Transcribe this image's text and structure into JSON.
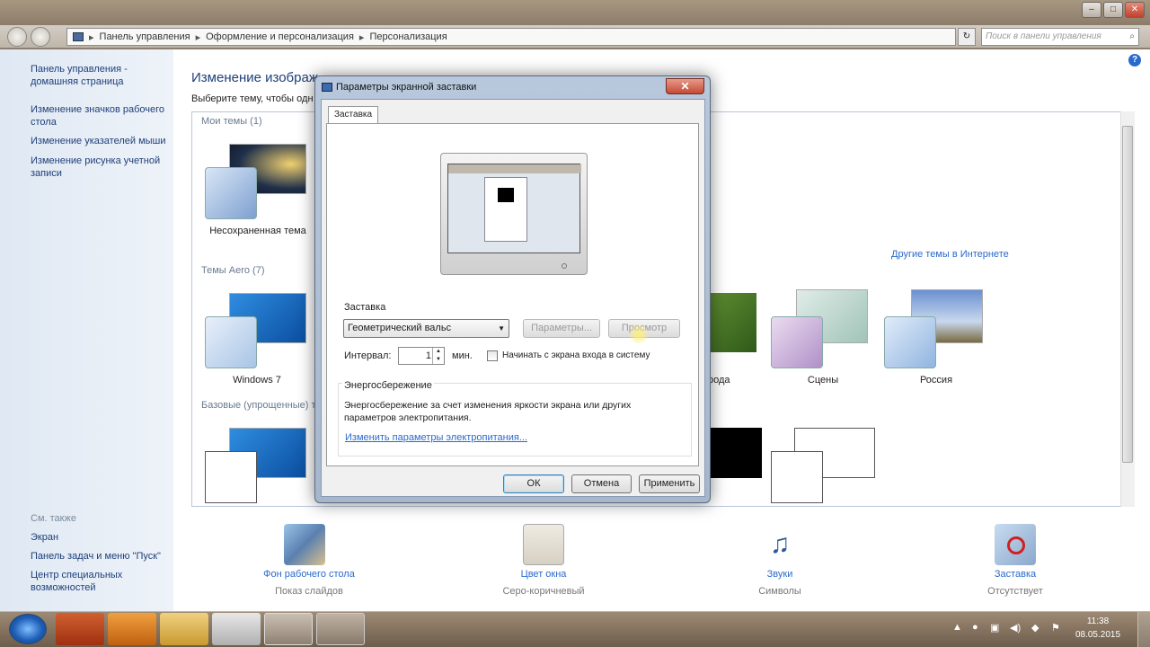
{
  "explorer": {
    "breadcrumb": [
      "Панель управления",
      "Оформление и персонализация",
      "Персонализация"
    ],
    "search_placeholder": "Поиск в панели управления"
  },
  "sidebar": {
    "links": [
      "Панель управления - домашняя страница",
      "Изменение значков рабочего стола",
      "Изменение указателей мыши",
      "Изменение рисунка учетной записи"
    ],
    "see_also_heading": "См. также",
    "see_also": [
      "Экран",
      "Панель задач и меню \"Пуск\"",
      "Центр специальных возможностей"
    ]
  },
  "main": {
    "title": "Изменение изображ",
    "subtitle": "Выберите тему, чтобы одн",
    "groups": {
      "my_themes": "Мои темы (1)",
      "aero": "Темы Aero (7)",
      "basic": "Базовые (упрощенные) т"
    },
    "themes": {
      "unsaved": "Несохраненная тема",
      "win7": "Windows 7",
      "nature": "рода",
      "scenes": "Сцены",
      "russia": "Россия"
    },
    "more_themes_link": "Другие темы в Интернете"
  },
  "bottom": [
    {
      "label": "Фон рабочего стола",
      "sub": "Показ слайдов"
    },
    {
      "label": "Цвет окна",
      "sub": "Серо-коричневый"
    },
    {
      "label": "Звуки",
      "sub": "Символы"
    },
    {
      "label": "Заставка",
      "sub": "Отсутствует"
    }
  ],
  "dialog": {
    "title": "Параметры экранной заставки",
    "tab": "Заставка",
    "screensaver_label": "Заставка",
    "screensaver_value": "Геометрический вальс",
    "params_button": "Параметры...",
    "preview_button": "Просмотр",
    "interval_label": "Интервал:",
    "interval_value": "1",
    "interval_unit": "мин.",
    "logon_checkbox": "Начинать с экрана входа в систему",
    "logon_checked": false,
    "energy_heading": "Энергосбережение",
    "energy_text": "Энергосбережение за счет изменения яркости экрана или других параметров электропитания.",
    "energy_link": "Изменить параметры электропитания...",
    "ok_button": "ОК",
    "cancel_button": "Отмена",
    "apply_button": "Применить"
  },
  "taskbar": {
    "time": "11:38",
    "date": "08.05.2015"
  }
}
